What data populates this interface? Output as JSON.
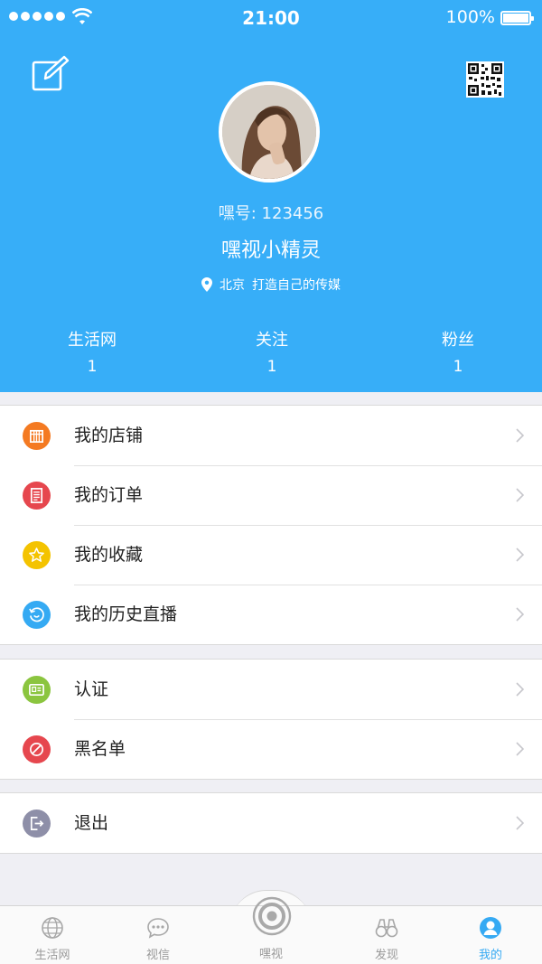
{
  "status_bar": {
    "time": "21:00",
    "battery": "100%"
  },
  "profile": {
    "id_label": "嘿号: 123456",
    "nickname": "嘿视小精灵",
    "location": "北京",
    "signature": "打造自己的传媒"
  },
  "stats": [
    {
      "label": "生活网",
      "value": "1"
    },
    {
      "label": "关注",
      "value": "1"
    },
    {
      "label": "粉丝",
      "value": "1"
    }
  ],
  "menu_group1": [
    {
      "label": "我的店铺",
      "icon": "store-icon",
      "color": "#f47a22"
    },
    {
      "label": "我的订单",
      "icon": "order-icon",
      "color": "#e6474e"
    },
    {
      "label": "我的收藏",
      "icon": "star-icon",
      "color": "#f4c300"
    },
    {
      "label": "我的历史直播",
      "icon": "history-icon",
      "color": "#35aaf3"
    }
  ],
  "menu_group2": [
    {
      "label": "认证",
      "icon": "id-card-icon",
      "color": "#8bc53f"
    },
    {
      "label": "黑名单",
      "icon": "block-icon",
      "color": "#e6474e"
    }
  ],
  "menu_group3": [
    {
      "label": "退出",
      "icon": "logout-icon",
      "color": "#8e8fa8"
    }
  ],
  "tabs": [
    {
      "label": "生活网",
      "icon": "globe-icon",
      "active": false
    },
    {
      "label": "视信",
      "icon": "chat-icon",
      "active": false
    },
    {
      "label": "嘿视",
      "icon": "camera-icon",
      "active": false
    },
    {
      "label": "发现",
      "icon": "binoculars-icon",
      "active": false
    },
    {
      "label": "我的",
      "icon": "user-icon",
      "active": true
    }
  ],
  "colors": {
    "header": "#37aef8",
    "accent": "#36aaf3"
  }
}
